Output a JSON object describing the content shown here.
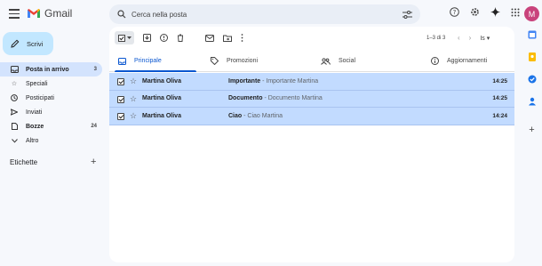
{
  "app": {
    "name": "Gmail"
  },
  "search": {
    "placeholder": "Cerca nella posta"
  },
  "user": {
    "avatar_letter": "M"
  },
  "compose": {
    "label": "Scrivi"
  },
  "sidebar": {
    "items": [
      {
        "label": "Posta in arrivo",
        "count": "3",
        "icon": "inbox-icon",
        "active": true
      },
      {
        "label": "Speciali",
        "count": "",
        "icon": "star-icon"
      },
      {
        "label": "Posticipati",
        "count": "",
        "icon": "clock-icon"
      },
      {
        "label": "Inviati",
        "count": "",
        "icon": "send-icon"
      },
      {
        "label": "Bozze",
        "count": "24",
        "icon": "draft-icon"
      },
      {
        "label": "Altro",
        "count": "",
        "icon": "chevron-down-icon"
      }
    ],
    "labels_heading": "Etichette"
  },
  "toolbar": {
    "pager_text": "1–3 di 3"
  },
  "tabs": [
    {
      "label": "Principale",
      "icon": "inbox-icon",
      "active": true
    },
    {
      "label": "Promozioni",
      "icon": "tag-icon"
    },
    {
      "label": "Social",
      "icon": "people-icon"
    },
    {
      "label": "Aggiornamenti",
      "icon": "info-icon"
    }
  ],
  "emails": [
    {
      "sender": "Martina Oliva",
      "subject": "Importante",
      "snippet": " - Importante Martina",
      "time": "14:25"
    },
    {
      "sender": "Martina Oliva",
      "subject": "Documento",
      "snippet": " - Documento Martina",
      "time": "14:25"
    },
    {
      "sender": "Martina Oliva",
      "subject": "Ciao",
      "snippet": " - Ciao Martina",
      "time": "14:24"
    }
  ],
  "colors": {
    "accent": "#0b57d0",
    "selected_row": "#c2dbff",
    "compose_bg": "#c2e7ff",
    "avatar": "#c9437c"
  }
}
